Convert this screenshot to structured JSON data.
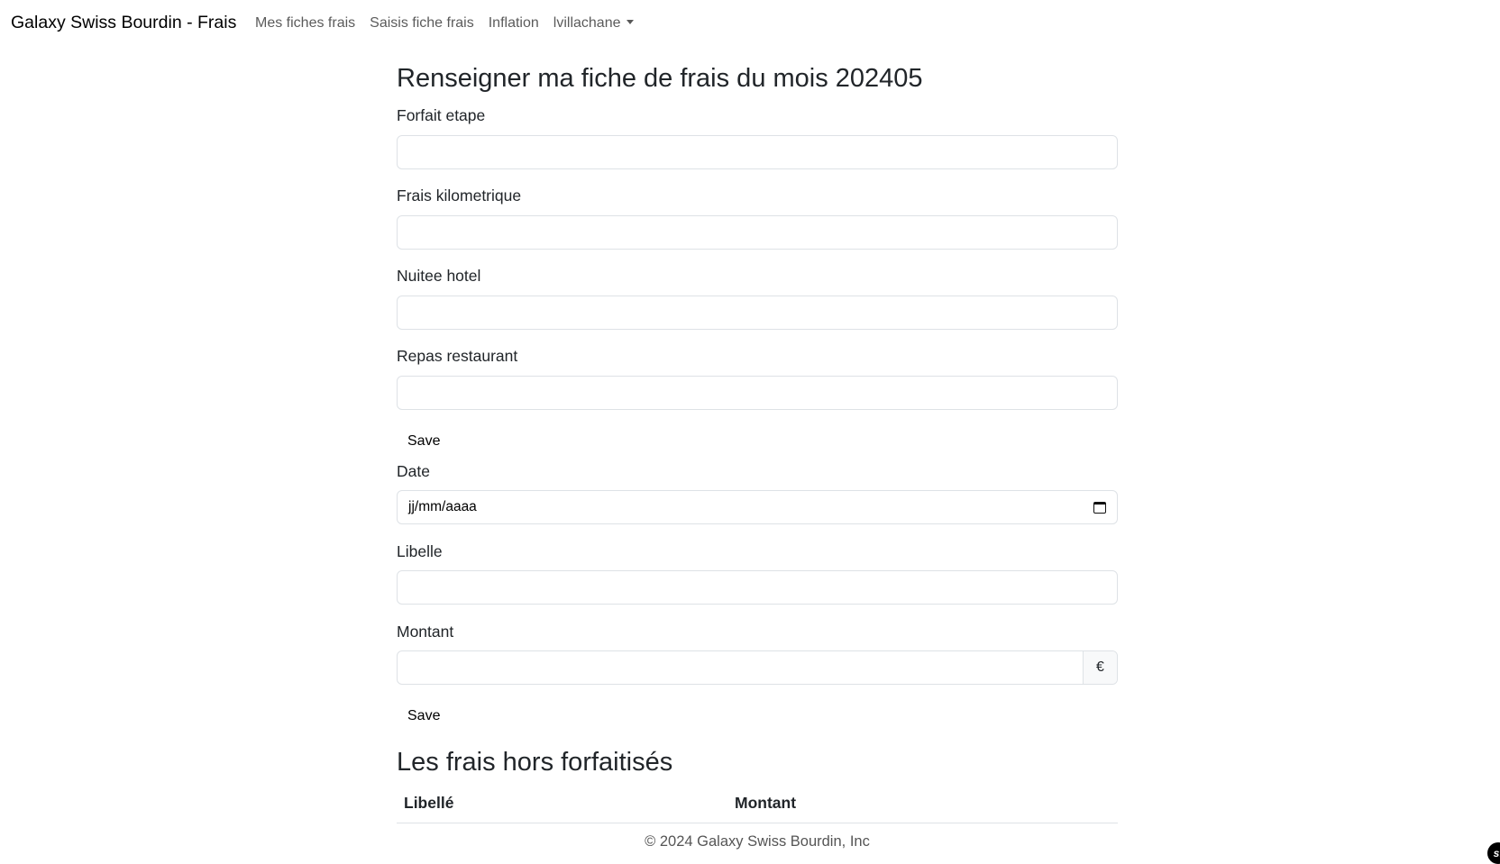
{
  "navbar": {
    "brand": "Galaxy Swiss Bourdin - Frais",
    "links": [
      "Mes fiches frais",
      "Saisis fiche frais",
      "Inflation"
    ],
    "user_menu": "lvillachane"
  },
  "page": {
    "title": "Renseigner ma fiche de frais du mois 202405"
  },
  "forfait_form": {
    "fields": [
      {
        "label": "Forfait etape",
        "value": ""
      },
      {
        "label": "Frais kilometrique",
        "value": ""
      },
      {
        "label": "Nuitee hotel",
        "value": ""
      },
      {
        "label": "Repas restaurant",
        "value": ""
      }
    ],
    "save_label": "Save"
  },
  "hors_forfait_form": {
    "date_label": "Date",
    "date_placeholder": "jj/mm/aaaa",
    "libelle_label": "Libelle",
    "libelle_value": "",
    "montant_label": "Montant",
    "montant_value": "",
    "currency": "€",
    "save_label": "Save"
  },
  "hors_forfait_table": {
    "title": "Les frais hors forfaitisés",
    "columns": [
      "Libellé",
      "Montant"
    ],
    "rows": []
  },
  "footer": {
    "text": "© 2024 Galaxy Swiss Bourdin, Inc"
  },
  "debug_toolbar": {
    "icon": "symfony-icon",
    "glyph": "sf"
  }
}
